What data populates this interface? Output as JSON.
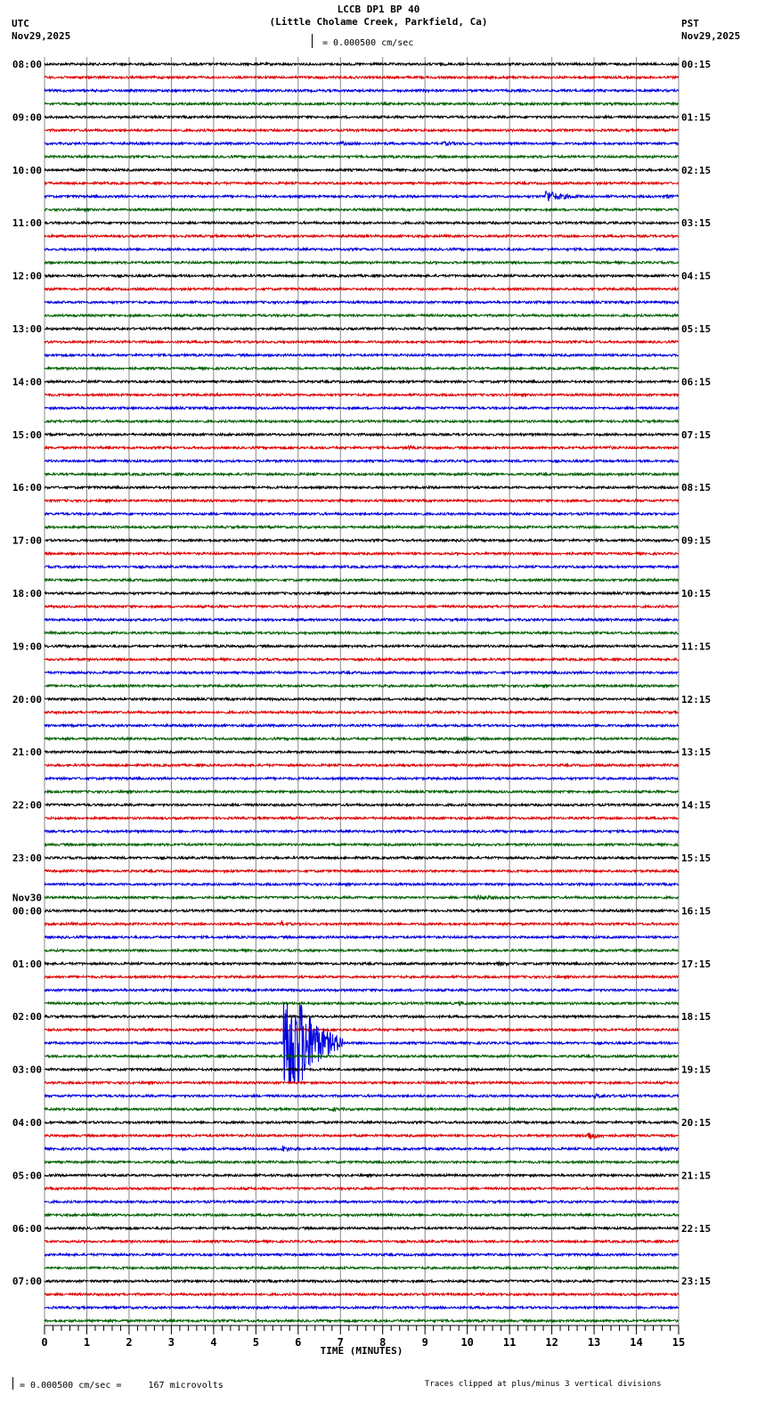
{
  "header": {
    "title": "LCCB DP1 BP 40",
    "subtitle": "(Little Cholame Creek, Parkfield, Ca)",
    "left_tz": "UTC",
    "left_date": "Nov29,2025",
    "right_tz": "PST",
    "right_date": "Nov29,2025",
    "scale_text": "= 0.000500 cm/sec"
  },
  "footer": {
    "scale_text": "= 0.000500 cm/sec =     167 microvolts",
    "clip_note": "Traces clipped at plus/minus 3 vertical divisions"
  },
  "chart_data": {
    "type": "line",
    "title": "LCCB DP1 BP 40",
    "xlabel": "TIME (MINUTES)",
    "xlim": [
      0,
      15
    ],
    "x_ticks": [
      "0",
      "1",
      "2",
      "3",
      "4",
      "5",
      "6",
      "7",
      "8",
      "9",
      "10",
      "11",
      "12",
      "13",
      "14",
      "15"
    ],
    "trace_count": 96,
    "trace_colors": [
      "#000000",
      "#e00000",
      "#0000e0",
      "#006000"
    ],
    "clip_divisions": 3,
    "date_change_label": "Nov30",
    "utc_labels": [
      "08:00",
      "09:00",
      "10:00",
      "11:00",
      "12:00",
      "13:00",
      "14:00",
      "15:00",
      "16:00",
      "17:00",
      "18:00",
      "19:00",
      "20:00",
      "21:00",
      "22:00",
      "23:00",
      "00:00",
      "01:00",
      "02:00",
      "03:00",
      "04:00",
      "05:00",
      "06:00",
      "07:00"
    ],
    "pst_labels": [
      "00:15",
      "01:15",
      "02:15",
      "03:15",
      "04:15",
      "05:15",
      "06:15",
      "07:15",
      "08:15",
      "09:15",
      "10:15",
      "11:15",
      "12:15",
      "13:15",
      "14:15",
      "15:15",
      "16:15",
      "17:15",
      "18:15",
      "19:15",
      "20:15",
      "21:15",
      "22:15",
      "23:15"
    ],
    "events": [
      {
        "trace": 6,
        "minute": 7.0,
        "amp": 1.2,
        "dur": 0.6
      },
      {
        "trace": 6,
        "minute": 9.4,
        "amp": 1.5,
        "dur": 0.8
      },
      {
        "trace": 10,
        "minute": 11.85,
        "amp": 7,
        "dur": 0.9
      },
      {
        "trace": 10,
        "minute": 14.7,
        "amp": 2,
        "dur": 0.3
      },
      {
        "trace": 29,
        "minute": 8.6,
        "amp": 1.5,
        "dur": 0.3
      },
      {
        "trace": 29,
        "minute": 13.3,
        "amp": 2,
        "dur": 0.3
      },
      {
        "trace": 51,
        "minute": 9.9,
        "amp": 2,
        "dur": 0.3
      },
      {
        "trace": 63,
        "minute": 10.2,
        "amp": 2.5,
        "dur": 0.8
      },
      {
        "trace": 65,
        "minute": 5.6,
        "amp": 2.5,
        "dur": 0.3
      },
      {
        "trace": 68,
        "minute": 10.7,
        "amp": 1.5,
        "dur": 0.6
      },
      {
        "trace": 71,
        "minute": 9.8,
        "amp": 2,
        "dur": 0.3
      },
      {
        "trace": 74,
        "minute": 5.65,
        "amp": 120,
        "dur": 1.4
      },
      {
        "trace": 78,
        "minute": 13.0,
        "amp": 1.5,
        "dur": 0.8
      },
      {
        "trace": 79,
        "minute": 6.8,
        "amp": 2,
        "dur": 0.3
      },
      {
        "trace": 81,
        "minute": 12.85,
        "amp": 5,
        "dur": 0.5
      },
      {
        "trace": 82,
        "minute": 5.6,
        "amp": 3.5,
        "dur": 0.4
      },
      {
        "trace": 82,
        "minute": 14.5,
        "amp": 2.5,
        "dur": 0.6
      }
    ]
  }
}
